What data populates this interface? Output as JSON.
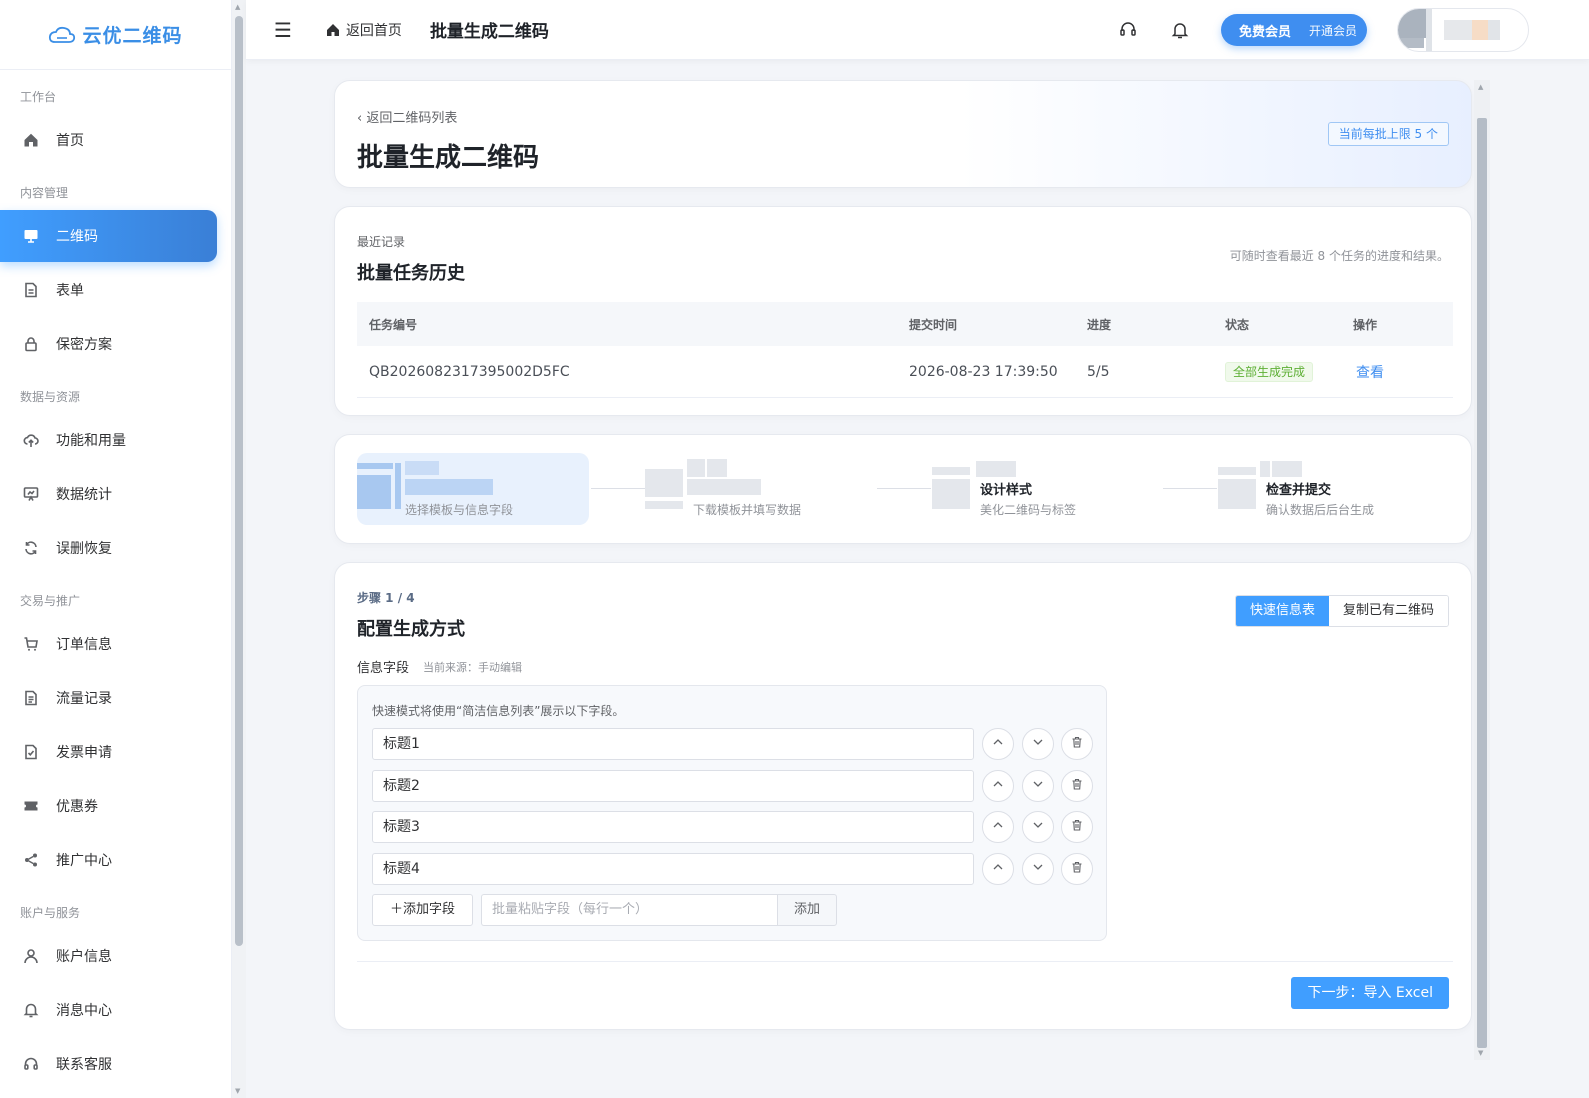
{
  "brand": {
    "name": "云优二维码"
  },
  "sidebar": {
    "groups": [
      {
        "title": "工作台",
        "items": [
          {
            "label": "首页",
            "icon": "home-icon"
          }
        ]
      },
      {
        "title": "内容管理",
        "items": [
          {
            "label": "二维码",
            "icon": "monitor-icon",
            "active": true
          },
          {
            "label": "表单",
            "icon": "document-icon"
          },
          {
            "label": "保密方案",
            "icon": "lock-icon"
          }
        ]
      },
      {
        "title": "数据与资源",
        "items": [
          {
            "label": "功能和用量",
            "icon": "cloud-upload-icon"
          },
          {
            "label": "数据统计",
            "icon": "chart-board-icon"
          },
          {
            "label": "误删恢复",
            "icon": "refresh-icon"
          }
        ]
      },
      {
        "title": "交易与推广",
        "items": [
          {
            "label": "订单信息",
            "icon": "cart-icon"
          },
          {
            "label": "流量记录",
            "icon": "list-doc-icon"
          },
          {
            "label": "发票申请",
            "icon": "invoice-icon"
          },
          {
            "label": "优惠券",
            "icon": "ticket-icon"
          },
          {
            "label": "推广中心",
            "icon": "share-icon"
          }
        ]
      },
      {
        "title": "账户与服务",
        "items": [
          {
            "label": "账户信息",
            "icon": "user-icon"
          },
          {
            "label": "消息中心",
            "icon": "bell-icon"
          },
          {
            "label": "联系客服",
            "icon": "headset-icon"
          }
        ]
      }
    ]
  },
  "header": {
    "home_link": "返回首页",
    "title": "批量生成二维码",
    "member_label": "免费会员",
    "upgrade_label": "开通会员"
  },
  "hero": {
    "back_link": "返回二维码列表",
    "title": "批量生成二维码",
    "limit_tag": "当前每批上限 5 个"
  },
  "history": {
    "label": "最近记录",
    "title": "批量任务历史",
    "note": "可随时查看最近 8 个任务的进度和结果。",
    "columns": [
      "任务编号",
      "提交时间",
      "进度",
      "状态",
      "操作"
    ],
    "rows": [
      {
        "id": "QB2026082317395002D5FC",
        "time": "2026-08-23 17:39:50",
        "progress": "5/5",
        "status": "全部生成完成",
        "action": "查看"
      }
    ]
  },
  "steps": [
    {
      "title": "",
      "desc": "选择模板与信息字段",
      "active": true
    },
    {
      "title": "",
      "desc": "下载模板并填写数据",
      "active": false
    },
    {
      "title": "设计样式",
      "desc": "美化二维码与标签",
      "active": false
    },
    {
      "title": "检查并提交",
      "desc": "确认数据后后台生成",
      "active": false
    }
  ],
  "config": {
    "step_label": "步骤 1 / 4",
    "title": "配置生成方式",
    "modes": [
      "快速信息表",
      "复制已有二维码"
    ],
    "active_mode": "快速信息表",
    "field_label": "信息字段",
    "field_source": "当前来源：手动编辑",
    "hint": "快速模式将使用“简洁信息列表”展示以下字段。",
    "fields": [
      "标题1",
      "标题2",
      "标题3",
      "标题4"
    ],
    "add_field": "＋添加字段",
    "paste_placeholder": "批量粘贴字段（每行一个）",
    "paste_add": "添加",
    "next": "下一步：导入 Excel"
  },
  "colors": {
    "primary": "#409eff",
    "brand": "#3a8ee6",
    "success": "#5daf34"
  }
}
